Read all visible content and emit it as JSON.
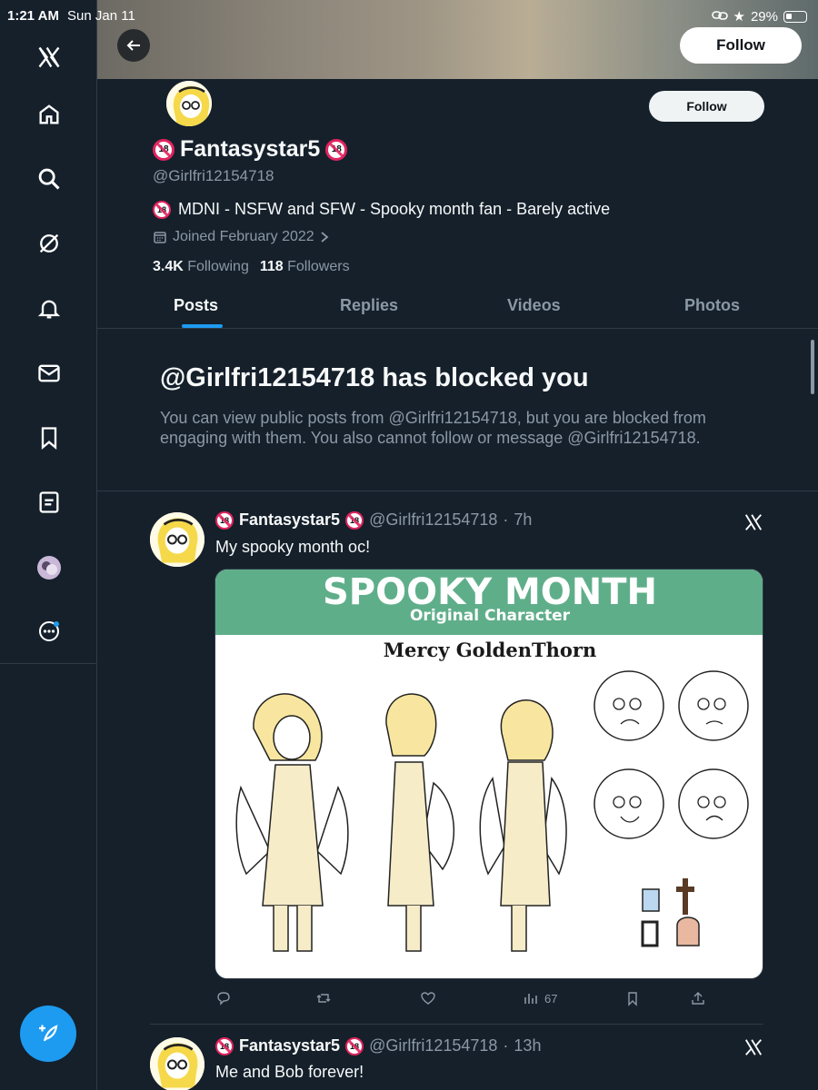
{
  "status_bar": {
    "time": "1:21 AM",
    "date": "Sun Jan 11",
    "battery": "29%"
  },
  "sidebar": {
    "items": [
      {
        "name": "x-logo-icon"
      },
      {
        "name": "home-icon"
      },
      {
        "name": "search-icon"
      },
      {
        "name": "grok-icon"
      },
      {
        "name": "notifications-icon"
      },
      {
        "name": "messages-icon"
      },
      {
        "name": "bookmarks-icon"
      },
      {
        "name": "lists-icon"
      },
      {
        "name": "profile-avatar"
      },
      {
        "name": "more-icon"
      }
    ]
  },
  "header": {
    "follow_label": "Follow"
  },
  "profile": {
    "display_name": "Fantasystar5",
    "handle": "@Girlfri12154718",
    "bio": "MDNI - NSFW and SFW - Spooky month fan - Barely active",
    "joined": "Joined February 2022",
    "following_count": "3.4K",
    "following_label": "Following",
    "followers_count": "118",
    "followers_label": "Followers",
    "follow_label": "Follow"
  },
  "tabs": [
    "Posts",
    "Replies",
    "Videos",
    "Photos"
  ],
  "active_tab": "Posts",
  "blocked": {
    "title": "@Girlfri12154718 has blocked you",
    "message": "You can view public posts from @Girlfri12154718, but you are blocked from engaging with them. You also cannot follow or message @Girlfri12154718."
  },
  "tweets": [
    {
      "name": "Fantasystar5",
      "handle": "@Girlfri12154718",
      "time": "7h",
      "text": "My spooky month oc!",
      "media": {
        "title": "SPOOKY MONTH",
        "subtitle": "Original Character",
        "character": "Mercy GoldenThorn"
      },
      "views": "67"
    },
    {
      "name": "Fantasystar5",
      "handle": "@Girlfri12154718",
      "time": "13h",
      "text": "Me and Bob forever!"
    }
  ],
  "colors": {
    "accent": "#1d9bf0",
    "background": "#15202b",
    "muted": "#8b98a5",
    "badge_red": "#e0245e"
  }
}
